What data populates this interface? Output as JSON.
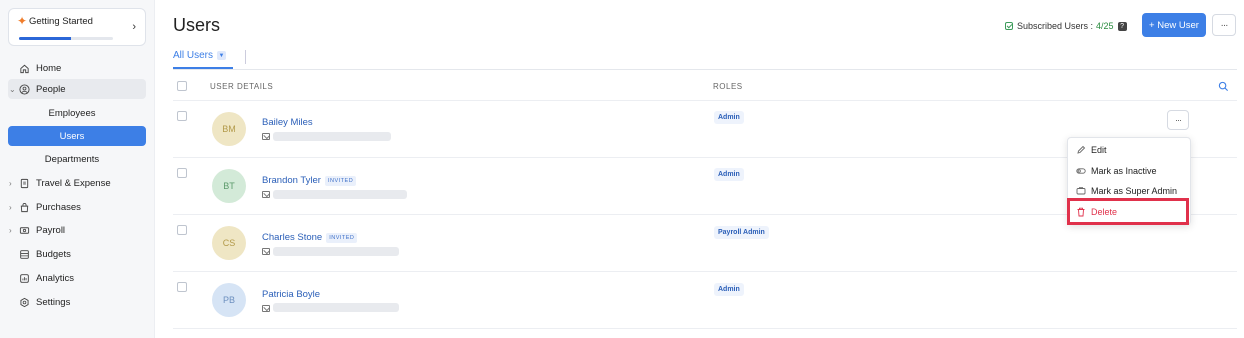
{
  "sidebar": {
    "getting_started": {
      "title": "Getting Started",
      "progress": 0.55
    },
    "items": [
      {
        "label": "Home"
      },
      {
        "label": "People"
      },
      {
        "label": "Employees"
      },
      {
        "label": "Users"
      },
      {
        "label": "Departments"
      },
      {
        "label": "Travel & Expense"
      },
      {
        "label": "Purchases"
      },
      {
        "label": "Payroll"
      },
      {
        "label": "Budgets"
      },
      {
        "label": "Analytics"
      },
      {
        "label": "Settings"
      }
    ]
  },
  "header": {
    "title": "Users",
    "subscribed_label": "Subscribed Users :",
    "subscribed_count": "4/25",
    "new_user_label": "+ New User",
    "more_label": "···"
  },
  "view": {
    "label": "All Users"
  },
  "table": {
    "columns": [
      "USER DETAILS",
      "ROLES"
    ],
    "rows": [
      {
        "initials": "BM",
        "name": "Bailey Miles",
        "badge": "",
        "role": "Admin",
        "avatar_color": "#efe6c4",
        "initials_color": "#b39a4a"
      },
      {
        "initials": "BT",
        "name": "Brandon Tyler",
        "badge": "INVITED",
        "role": "Admin",
        "avatar_color": "#d3ead8",
        "initials_color": "#5c9a6b"
      },
      {
        "initials": "CS",
        "name": "Charles Stone",
        "badge": "INVITED",
        "role": "Payroll Admin",
        "avatar_color": "#efe6c4",
        "initials_color": "#b39a4a"
      },
      {
        "initials": "PB",
        "name": "Patricia Boyle",
        "badge": "",
        "role": "Admin",
        "avatar_color": "#d6e4f5",
        "initials_color": "#6c8fbf"
      }
    ]
  },
  "row_menu": {
    "more_label": "···",
    "items": [
      {
        "label": "Edit",
        "icon": "pencil-icon"
      },
      {
        "label": "Mark as Inactive",
        "icon": "toggle-off-icon"
      },
      {
        "label": "Mark as Super Admin",
        "icon": "admin-icon"
      },
      {
        "label": "Delete",
        "icon": "trash-icon"
      }
    ]
  },
  "colors": {
    "accent": "#3d7fe6",
    "danger": "#e0314b",
    "success": "#2a8b3f"
  }
}
